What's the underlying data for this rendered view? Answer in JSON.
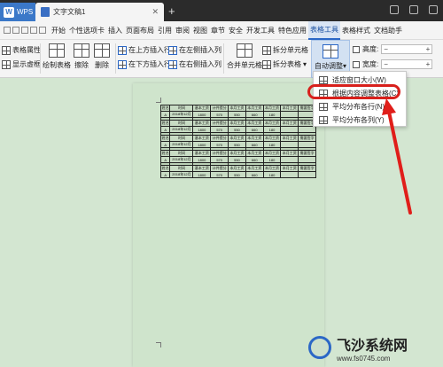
{
  "titlebar": {
    "app_tab": "WPS",
    "doc_tab": "文字文稿1"
  },
  "menubar": {
    "items": [
      "开始",
      "个性选项卡",
      "插入",
      "页面布局",
      "引用",
      "审阅",
      "视图",
      "章节",
      "安全",
      "开发工具",
      "特色应用",
      "表格工具",
      "表格样式",
      "文档助手"
    ],
    "active_index": 11
  },
  "ribbon": {
    "table_props": "表格属性",
    "show_gridlines": "显示虚框",
    "draw_table": "绘制表格",
    "erase": "擦除",
    "delete": "删除",
    "insert_above": "在上方插入行",
    "insert_below": "在下方插入行",
    "insert_left": "在左侧插入列",
    "insert_right": "在右侧插入列",
    "merge_cells": "合并单元格",
    "split_cells": "拆分单元格",
    "split_table": "拆分表格",
    "auto_fit": "自动调整",
    "height_label": "高度:",
    "width_label": "宽度:",
    "height_minus": "−",
    "height_plus": "+",
    "width_minus": "−",
    "width_plus": "+"
  },
  "dropdown": {
    "items": [
      "适应窗口大小(W)",
      "根据内容调整表格(C)",
      "平均分布各行(N)",
      "平均分布各列(Y)"
    ]
  },
  "table": {
    "header": [
      "姓名",
      "时间",
      "基本工资",
      "计件提分",
      "本月工资",
      "本月工资",
      "本月工资",
      "本月工资",
      "需要签字"
    ],
    "row": [
      "A",
      "2018年12月",
      "1800",
      "570",
      "550",
      "660",
      "180",
      "",
      ""
    ]
  },
  "watermark": {
    "title": "飞沙系统网",
    "url": "www.fs0745.com"
  },
  "colors": {
    "accent": "#2b67c6",
    "highlight": "#d8201c",
    "page_bg": "#cfe4cc"
  }
}
